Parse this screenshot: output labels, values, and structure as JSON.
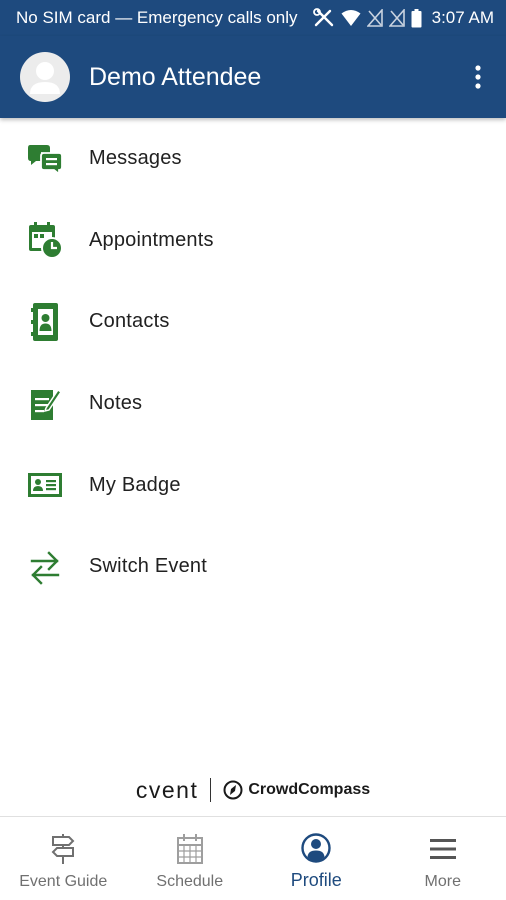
{
  "status_bar": {
    "text": "No SIM card — Emergency calls only",
    "time": "3:07 AM"
  },
  "header": {
    "title": "Demo Attendee"
  },
  "menu": [
    {
      "label": "Messages",
      "icon": "messages-icon"
    },
    {
      "label": "Appointments",
      "icon": "calendar-clock-icon"
    },
    {
      "label": "Contacts",
      "icon": "contact-book-icon"
    },
    {
      "label": "Notes",
      "icon": "note-edit-icon"
    },
    {
      "label": "My Badge",
      "icon": "badge-icon"
    },
    {
      "label": "Switch Event",
      "icon": "swap-arrows-icon"
    }
  ],
  "branding": {
    "primary": "cvent",
    "secondary": "CrowdCompass"
  },
  "bottom_nav": [
    {
      "label": "Event Guide",
      "icon": "signpost-icon",
      "active": false
    },
    {
      "label": "Schedule",
      "icon": "calendar-icon",
      "active": false
    },
    {
      "label": "Profile",
      "icon": "profile-icon",
      "active": true
    },
    {
      "label": "More",
      "icon": "menu-icon",
      "active": false
    }
  ],
  "colors": {
    "header_bg": "#1e4a7e",
    "icon_green": "#2e7d32",
    "active_tab": "#1e4a7e",
    "inactive_tab": "#707070"
  }
}
